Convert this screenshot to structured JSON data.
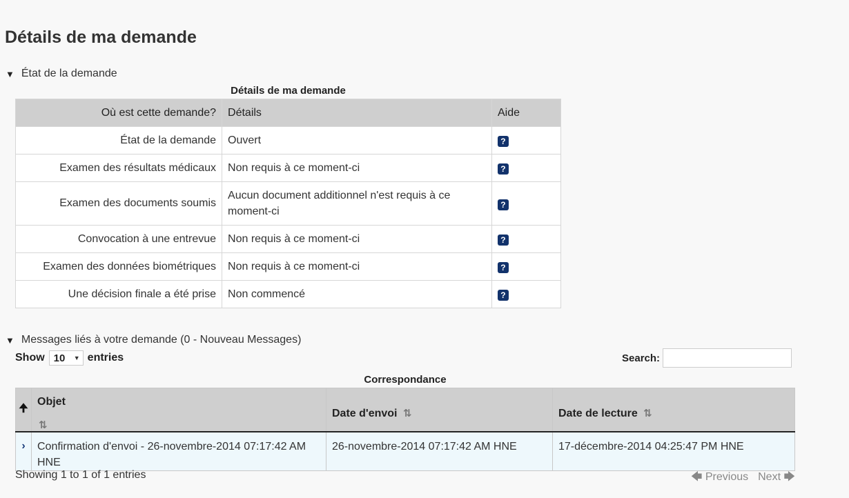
{
  "page": {
    "title": "Détails de ma demande"
  },
  "status_section": {
    "toggle_label": "État de la demande",
    "caption": "Détails de ma demande",
    "headers": [
      "Où est cette demande?",
      "Détails",
      "Aide"
    ],
    "help_glyph": "?",
    "rows": [
      {
        "stage": "État de la demande",
        "detail": "Ouvert"
      },
      {
        "stage": "Examen des résultats médicaux",
        "detail": "Non requis à ce moment-ci"
      },
      {
        "stage": "Examen des documents soumis",
        "detail": "Aucun document additionnel n'est requis à ce moment-ci"
      },
      {
        "stage": "Convocation à une entrevue",
        "detail": "Non requis à ce moment-ci"
      },
      {
        "stage": "Examen des données biométriques",
        "detail": "Non requis à ce moment-ci"
      },
      {
        "stage": "Une décision finale a été prise",
        "detail": "Non commencé"
      }
    ]
  },
  "messages_section": {
    "toggle_label": "Messages liés à votre demande (0 - Nouveau Messages)",
    "show_label": "Show",
    "page_size": "10",
    "entries_label": "entries",
    "search_label": "Search:",
    "search_value": "",
    "caption": "Correspondance",
    "headers": {
      "subject": "Objet",
      "sent": "Date d'envoi",
      "read": "Date de lecture"
    },
    "rows": [
      {
        "subject": "Confirmation d'envoi - 26-novembre-2014 07:17:42 AM HNE",
        "sent": "26-novembre-2014 07:17:42 AM HNE",
        "read": "17-décembre-2014 04:25:47 PM HNE"
      }
    ],
    "info": "Showing 1 to 1 of 1 entries",
    "previous_label": "Previous",
    "next_label": "Next"
  },
  "icons": {
    "triangle": "triangle-down-icon",
    "help": "question-icon",
    "sort": "sort-icon",
    "expand": "chevron-right-icon",
    "arrow_up": "arrow-up-icon",
    "arrow_left": "arrow-left-icon",
    "arrow_right": "arrow-right-icon"
  },
  "colors": {
    "help_icon": "#12326b",
    "header_bg": "#cfcfcf",
    "row_highlight": "#eef8fc"
  }
}
